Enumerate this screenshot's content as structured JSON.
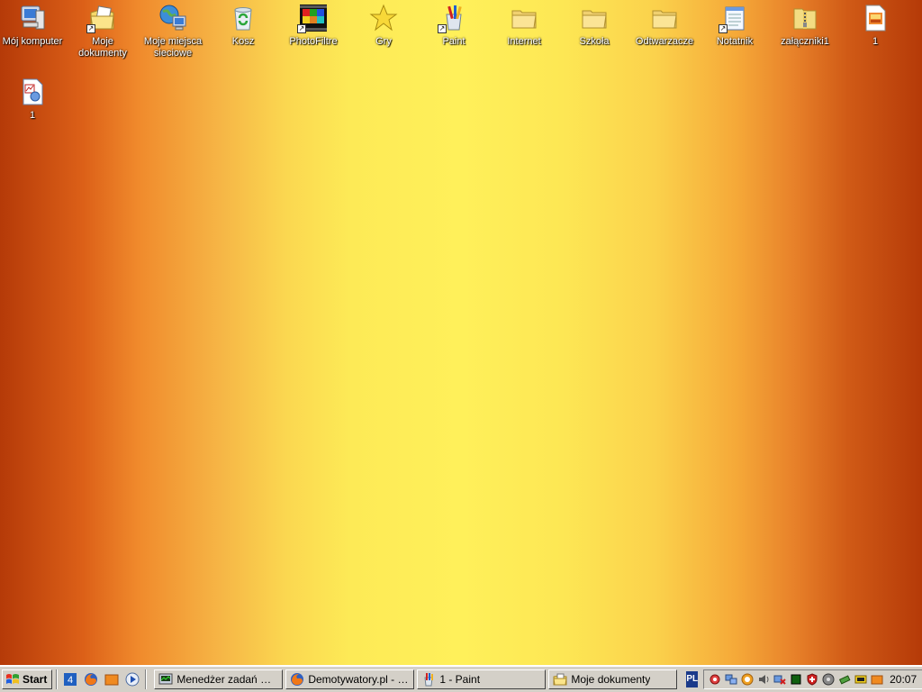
{
  "desktop": {
    "icons": [
      {
        "label": "Mój komputer",
        "icon": "my-computer-icon"
      },
      {
        "label": "Moje dokumenty",
        "icon": "my-documents-icon"
      },
      {
        "label": "Moje miejsca sieciowe",
        "icon": "network-places-icon"
      },
      {
        "label": "Kosz",
        "icon": "recycle-bin-icon"
      },
      {
        "label": "PhotoFiltre",
        "icon": "photofiltre-icon"
      },
      {
        "label": "Gry",
        "icon": "star-icon"
      },
      {
        "label": "Paint",
        "icon": "paint-icon"
      },
      {
        "label": "Internet",
        "icon": "folder-icon"
      },
      {
        "label": "Szkoła",
        "icon": "folder-icon"
      },
      {
        "label": "Odtwarzacze",
        "icon": "folder-icon"
      },
      {
        "label": "Notatnik",
        "icon": "notepad-icon"
      },
      {
        "label": "załączniki1",
        "icon": "zip-folder-icon"
      },
      {
        "label": "1",
        "icon": "image-file-icon"
      },
      {
        "label": "1",
        "icon": "paint-file-icon"
      }
    ]
  },
  "taskbar": {
    "start_label": "Start",
    "tasks": [
      {
        "label": "Menedżer zadań Win...",
        "icon": "task-manager-icon"
      },
      {
        "label": "Demotywatory.pl - M...",
        "icon": "firefox-icon"
      },
      {
        "label": "1 - Paint",
        "icon": "paint-icon"
      },
      {
        "label": "Moje dokumenty",
        "icon": "my-documents-icon"
      }
    ],
    "language": "PL",
    "clock": "20:07"
  }
}
